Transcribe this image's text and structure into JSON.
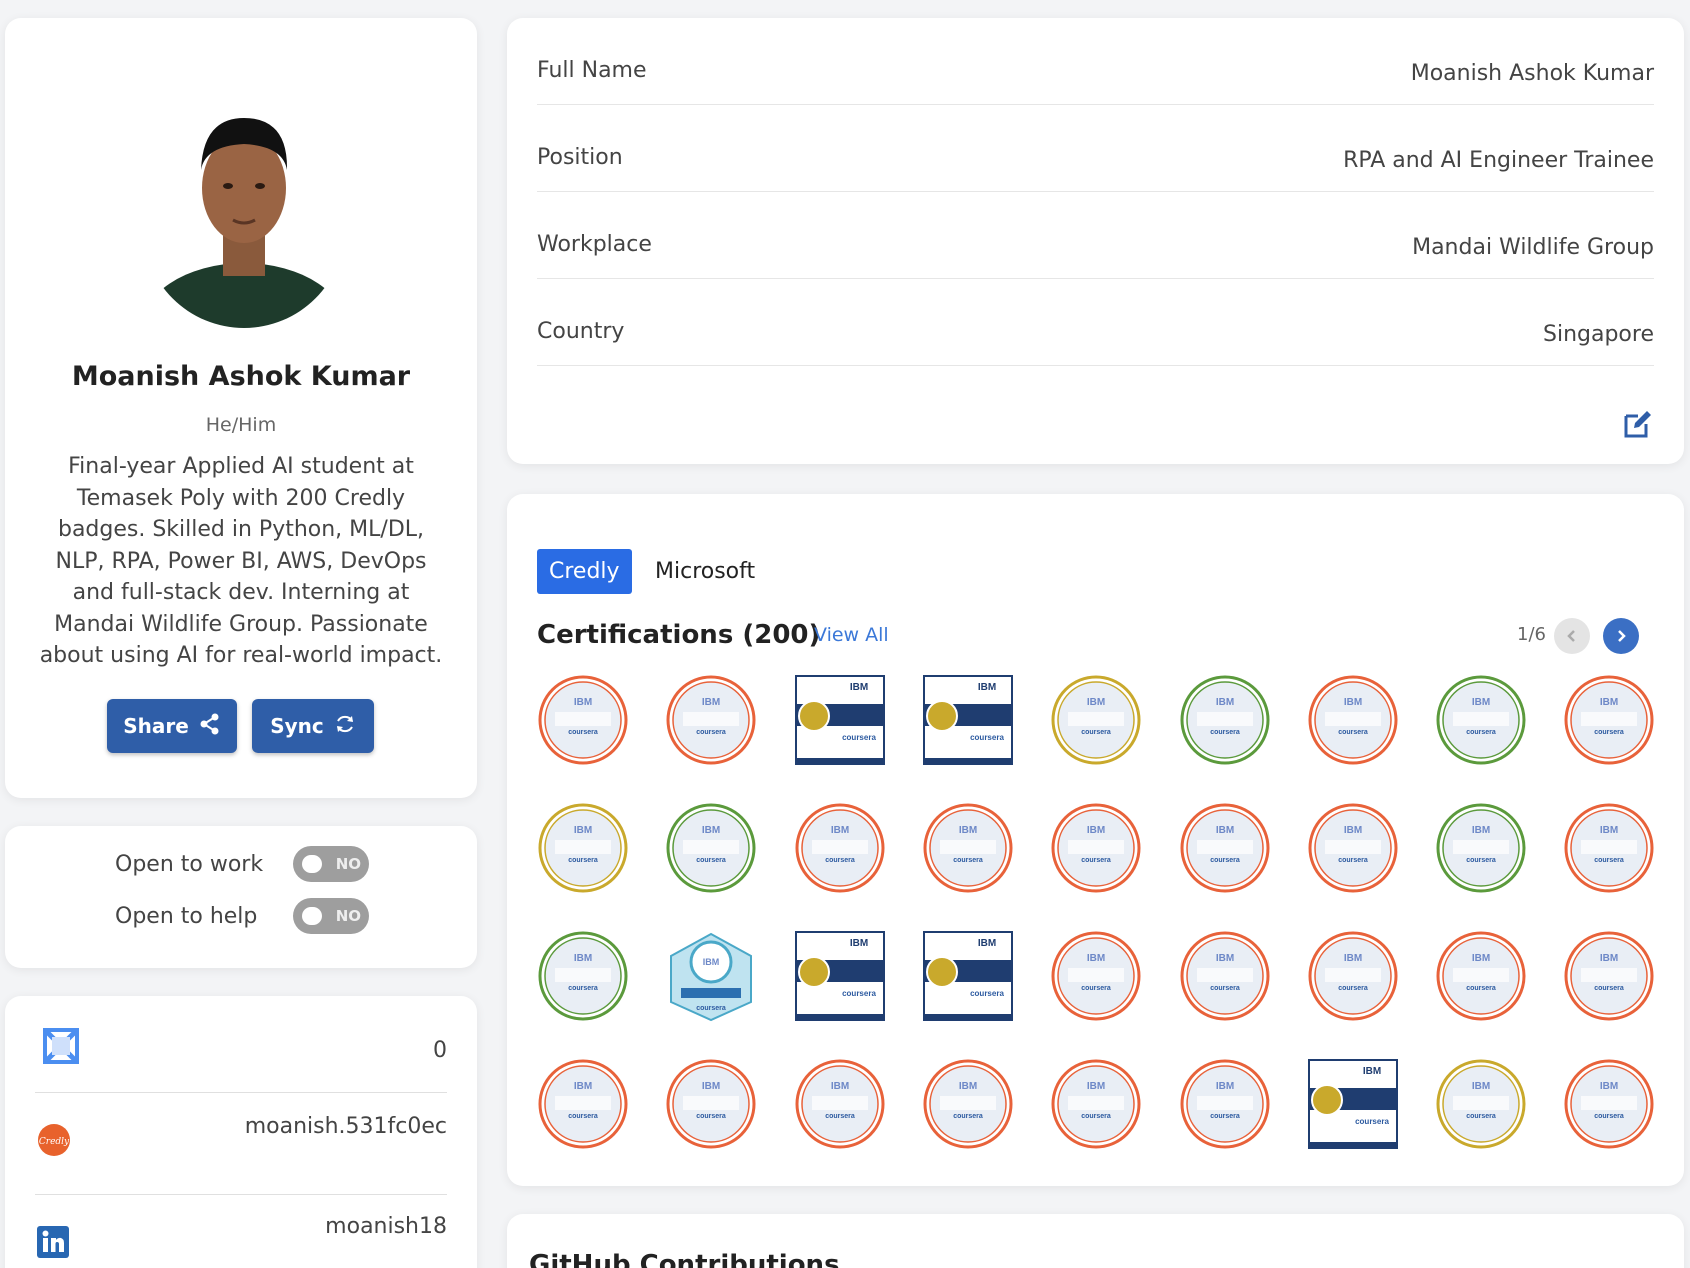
{
  "profile": {
    "name": "Moanish Ashok Kumar",
    "pronouns": "He/Him",
    "bio": "Final-year Applied AI student at Temasek Poly with 200 Credly badges. Skilled in Python, ML/DL, NLP, RPA, Power BI, AWS, DevOps and full-stack dev. Interning at Mandai Wildlife Group. Passionate about using AI for real-world impact.",
    "share_label": "Share",
    "sync_label": "Sync"
  },
  "status": {
    "open_to_work_label": "Open to work",
    "open_to_work_value": "NO",
    "open_to_help_label": "Open to help",
    "open_to_help_value": "NO"
  },
  "links": [
    {
      "icon": "codepen-icon",
      "value": "0"
    },
    {
      "icon": "credly-icon",
      "value": "moanish.531fc0ec"
    },
    {
      "icon": "linkedin-icon",
      "value": "moanish18"
    }
  ],
  "info": {
    "rows": [
      {
        "label": "Full Name",
        "value": "Moanish Ashok Kumar"
      },
      {
        "label": "Position",
        "value": "RPA and AI Engineer Trainee"
      },
      {
        "label": "Workplace",
        "value": "Mandai Wildlife Group"
      },
      {
        "label": "Country",
        "value": "Singapore"
      }
    ]
  },
  "certifications": {
    "tabs": [
      "Credly",
      "Microsoft"
    ],
    "active_tab": "Credly",
    "title": "Certifications (200)",
    "view_all": "View All",
    "page": "1/6",
    "badges": [
      {
        "shape": "circle",
        "ring": "#e8623a",
        "text": "Build AI Applications"
      },
      {
        "shape": "circle",
        "ring": "#e8623a",
        "text": "Generative AI Applications"
      },
      {
        "shape": "square",
        "ring": "#1f3d70",
        "text": "Data Analyst"
      },
      {
        "shape": "square",
        "ring": "#1f3d70",
        "text": "Data Science"
      },
      {
        "shape": "circle",
        "ring": "#c9a92c",
        "text": "Applied Data Science"
      },
      {
        "shape": "circle",
        "ring": "#5b9a3c",
        "text": "Data Science Career Guide"
      },
      {
        "shape": "circle",
        "ring": "#e8623a",
        "text": "Generative AI for Data Science"
      },
      {
        "shape": "circle",
        "ring": "#5b9a3c",
        "text": "Data Science Methodology"
      },
      {
        "shape": "circle",
        "ring": "#e8623a",
        "text": "Tools for Data Science"
      },
      {
        "shape": "circle",
        "ring": "#c9a92c",
        "text": "Data Analyst"
      },
      {
        "shape": "circle",
        "ring": "#5b9a3c",
        "text": "Data Science Orientation"
      },
      {
        "shape": "circle",
        "ring": "#e8623a",
        "text": "Generative AI for Data Analytics"
      },
      {
        "shape": "circle",
        "ring": "#e8623a",
        "text": "Data Visualization with Python"
      },
      {
        "shape": "circle",
        "ring": "#e8623a",
        "text": "Databases and SQL"
      },
      {
        "shape": "circle",
        "ring": "#e8623a",
        "text": "Python Project"
      },
      {
        "shape": "circle",
        "ring": "#e8623a",
        "text": "Data Visualization Dashboards"
      },
      {
        "shape": "circle",
        "ring": "#5b9a3c",
        "text": "Data Analyst Career Guide"
      },
      {
        "shape": "circle",
        "ring": "#e8623a",
        "text": "Excel Essentials"
      },
      {
        "shape": "circle",
        "ring": "#5b9a3c",
        "text": "Data Analytics Essentials"
      },
      {
        "shape": "hex",
        "ring": "#4aa8c8",
        "text": "Generative AI"
      },
      {
        "shape": "square",
        "ring": "#1f3d70",
        "text": "AI Engineering"
      },
      {
        "shape": "square",
        "ring": "#1f3d70",
        "text": "AI Engineering"
      },
      {
        "shape": "circle",
        "ring": "#e8623a",
        "text": "AI Applications Specialist"
      },
      {
        "shape": "circle",
        "ring": "#e8623a",
        "text": "Python Project for AI"
      },
      {
        "shape": "circle",
        "ring": "#e8623a",
        "text": "Data Analysis with Python"
      },
      {
        "shape": "circle",
        "ring": "#e8623a",
        "text": "AI Agents RAG LangChain"
      },
      {
        "shape": "circle",
        "ring": "#e8623a",
        "text": "Fine-Tuning LLMs"
      },
      {
        "shape": "circle",
        "ring": "#e8623a",
        "text": "Generative AI Engineering"
      },
      {
        "shape": "circle",
        "ring": "#e8623a",
        "text": "Language Modeling"
      },
      {
        "shape": "circle",
        "ring": "#e8623a",
        "text": "Foundational Models for NLP"
      },
      {
        "shape": "circle",
        "ring": "#e8623a",
        "text": "Generative AI and LLMs"
      },
      {
        "shape": "circle",
        "ring": "#e8623a",
        "text": "Machine Learning with Python"
      },
      {
        "shape": "circle",
        "ring": "#e8623a",
        "text": "Deep Learning with PyTorch"
      },
      {
        "shape": "square",
        "ring": "#1f3d70",
        "text": "Deep Learning"
      },
      {
        "shape": "circle",
        "ring": "#c9a92c",
        "text": "Deep Learning"
      },
      {
        "shape": "circle",
        "ring": "#e8623a",
        "text": "Neural Networks with PyTorch"
      }
    ]
  },
  "github": {
    "title": "GitHub Contributions"
  },
  "colors": {
    "primary_button": "#2f5ea8",
    "active_tab": "#2a6ce4",
    "link": "#3b78d8"
  }
}
